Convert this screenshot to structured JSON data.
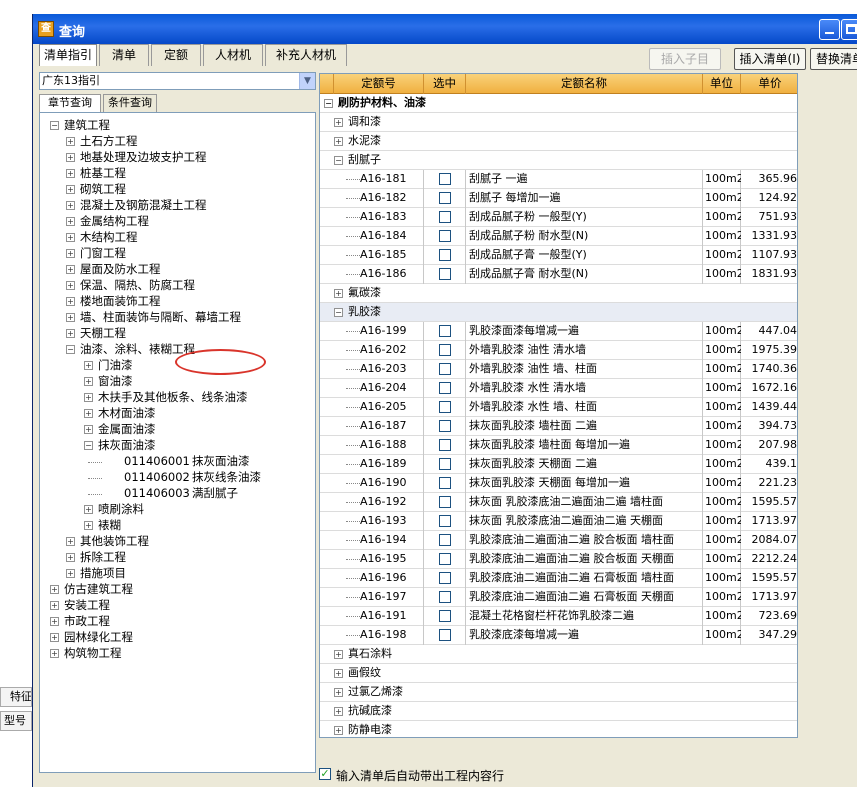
{
  "window": {
    "title": "查询"
  },
  "side": {
    "label1": "特征",
    "label2": "型号"
  },
  "tabs": [
    "清单指引",
    "清单",
    "定额",
    "人材机",
    "补充人材机"
  ],
  "toolbar": {
    "insert_child": "插入子目",
    "insert_list": "插入清单(I)",
    "replace_list": "替换清单"
  },
  "combo": {
    "value": "广东13指引"
  },
  "subtabs": [
    "章节查询",
    "条件查询"
  ],
  "tree": [
    {
      "label": "建筑工程",
      "level": 0,
      "exp": "-"
    },
    {
      "label": "土石方工程",
      "level": 1,
      "exp": "+"
    },
    {
      "label": "地基处理及边坡支护工程",
      "level": 1,
      "exp": "+"
    },
    {
      "label": "桩基工程",
      "level": 1,
      "exp": "+"
    },
    {
      "label": "砌筑工程",
      "level": 1,
      "exp": "+"
    },
    {
      "label": "混凝土及钢筋混凝土工程",
      "level": 1,
      "exp": "+"
    },
    {
      "label": "金属结构工程",
      "level": 1,
      "exp": "+"
    },
    {
      "label": "木结构工程",
      "level": 1,
      "exp": "+"
    },
    {
      "label": "门窗工程",
      "level": 1,
      "exp": "+"
    },
    {
      "label": "屋面及防水工程",
      "level": 1,
      "exp": "+"
    },
    {
      "label": "保温、隔热、防腐工程",
      "level": 1,
      "exp": "+"
    },
    {
      "label": "楼地面装饰工程",
      "level": 1,
      "exp": "+"
    },
    {
      "label": "墙、柱面装饰与隔断、幕墙工程",
      "level": 1,
      "exp": "+"
    },
    {
      "label": "天棚工程",
      "level": 1,
      "exp": "+"
    },
    {
      "label": "油漆、涂料、裱糊工程",
      "level": 1,
      "exp": "-"
    },
    {
      "label": "门油漆",
      "level": 2,
      "exp": "+"
    },
    {
      "label": "窗油漆",
      "level": 2,
      "exp": "+"
    },
    {
      "label": "木扶手及其他板条、线条油漆",
      "level": 2,
      "exp": "+"
    },
    {
      "label": "木材面油漆",
      "level": 2,
      "exp": "+"
    },
    {
      "label": "金属面油漆",
      "level": 2,
      "exp": "+"
    },
    {
      "label": "抹灰面油漆",
      "level": 2,
      "exp": "-"
    },
    {
      "label": "011406001",
      "label2": "抹灰面油漆",
      "level": 3,
      "exp": ""
    },
    {
      "label": "011406002",
      "label2": "抹灰线条油漆",
      "level": 3,
      "exp": ""
    },
    {
      "label": "011406003",
      "label2": "满刮腻子",
      "level": 3,
      "exp": ""
    },
    {
      "label": "喷刷涂料",
      "level": 2,
      "exp": "+"
    },
    {
      "label": "裱糊",
      "level": 2,
      "exp": "+"
    },
    {
      "label": "其他装饰工程",
      "level": 1,
      "exp": "+"
    },
    {
      "label": "拆除工程",
      "level": 1,
      "exp": "+"
    },
    {
      "label": "措施项目",
      "level": 1,
      "exp": "+"
    },
    {
      "label": "仿古建筑工程",
      "level": 0,
      "exp": "+"
    },
    {
      "label": "安装工程",
      "level": 0,
      "exp": "+"
    },
    {
      "label": "市政工程",
      "level": 0,
      "exp": "+"
    },
    {
      "label": "园林绿化工程",
      "level": 0,
      "exp": "+"
    },
    {
      "label": "构筑物工程",
      "level": 0,
      "exp": "+"
    }
  ],
  "grid": {
    "headers": [
      "定额号",
      "选中",
      "定额名称",
      "单位",
      "单价"
    ],
    "rows": [
      {
        "type": "group1",
        "exp": "-",
        "label": "刷防护材料、油漆"
      },
      {
        "type": "group",
        "exp": "+",
        "label": "调和漆"
      },
      {
        "type": "group",
        "exp": "+",
        "label": "水泥漆"
      },
      {
        "type": "group",
        "exp": "-",
        "label": "刮腻子"
      },
      {
        "type": "item",
        "code": "A16-181",
        "name": "刮腻子 一遍",
        "unit": "100m2",
        "price": "365.96"
      },
      {
        "type": "item",
        "code": "A16-182",
        "name": "刮腻子 每增加一遍",
        "unit": "100m2",
        "price": "124.92"
      },
      {
        "type": "item",
        "code": "A16-183",
        "name": "刮成品腻子粉 一般型(Y)",
        "unit": "100m2",
        "price": "751.93"
      },
      {
        "type": "item",
        "code": "A16-184",
        "name": "刮成品腻子粉 耐水型(N)",
        "unit": "100m2",
        "price": "1331.93"
      },
      {
        "type": "item",
        "code": "A16-185",
        "name": "刮成品腻子膏 一般型(Y)",
        "unit": "100m2",
        "price": "1107.93"
      },
      {
        "type": "item",
        "code": "A16-186",
        "name": "刮成品腻子膏 耐水型(N)",
        "unit": "100m2",
        "price": "1831.93"
      },
      {
        "type": "group",
        "exp": "+",
        "label": "氟碳漆"
      },
      {
        "type": "grouphl",
        "exp": "-",
        "label": "乳胶漆"
      },
      {
        "type": "item",
        "code": "A16-199",
        "name": "乳胶漆面漆每增减一遍",
        "unit": "100m2",
        "price": "447.04"
      },
      {
        "type": "item",
        "code": "A16-202",
        "name": "外墙乳胶漆 油性 清水墙",
        "unit": "100m2",
        "price": "1975.39"
      },
      {
        "type": "item",
        "code": "A16-203",
        "name": "外墙乳胶漆 油性 墙、柱面",
        "unit": "100m2",
        "price": "1740.36"
      },
      {
        "type": "item",
        "code": "A16-204",
        "name": "外墙乳胶漆 水性 清水墙",
        "unit": "100m2",
        "price": "1672.16"
      },
      {
        "type": "item",
        "code": "A16-205",
        "name": "外墙乳胶漆 水性 墙、柱面",
        "unit": "100m2",
        "price": "1439.44"
      },
      {
        "type": "item",
        "code": "A16-187",
        "name": "抹灰面乳胶漆 墙柱面 二遍",
        "unit": "100m2",
        "price": "394.73"
      },
      {
        "type": "item",
        "code": "A16-188",
        "name": "抹灰面乳胶漆 墙柱面 每增加一遍",
        "unit": "100m2",
        "price": "207.98"
      },
      {
        "type": "item",
        "code": "A16-189",
        "name": "抹灰面乳胶漆 天棚面 二遍",
        "unit": "100m2",
        "price": "439.1"
      },
      {
        "type": "item",
        "code": "A16-190",
        "name": "抹灰面乳胶漆 天棚面 每增加一遍",
        "unit": "100m2",
        "price": "221.23"
      },
      {
        "type": "item",
        "code": "A16-192",
        "name": "抹灰面 乳胶漆底油二遍面油二遍 墙柱面",
        "unit": "100m2",
        "price": "1595.57"
      },
      {
        "type": "item",
        "code": "A16-193",
        "name": "抹灰面 乳胶漆底油二遍面油二遍 天棚面",
        "unit": "100m2",
        "price": "1713.97"
      },
      {
        "type": "item",
        "code": "A16-194",
        "name": "乳胶漆底油二遍面油二遍 胶合板面 墙柱面",
        "unit": "100m2",
        "price": "2084.07"
      },
      {
        "type": "item",
        "code": "A16-195",
        "name": "乳胶漆底油二遍面油二遍 胶合板面 天棚面",
        "unit": "100m2",
        "price": "2212.24"
      },
      {
        "type": "item",
        "code": "A16-196",
        "name": "乳胶漆底油二遍面油二遍 石膏板面 墙柱面",
        "unit": "100m2",
        "price": "1595.57"
      },
      {
        "type": "item",
        "code": "A16-197",
        "name": "乳胶漆底油二遍面油二遍 石膏板面 天棚面",
        "unit": "100m2",
        "price": "1713.97"
      },
      {
        "type": "item",
        "code": "A16-191",
        "name": "混凝土花格窗栏杆花饰乳胶漆二遍",
        "unit": "100m2",
        "price": "723.69"
      },
      {
        "type": "item",
        "code": "A16-198",
        "name": "乳胶漆底漆每增减一遍",
        "unit": "100m2",
        "price": "347.29"
      },
      {
        "type": "group",
        "exp": "+",
        "label": "真石涂料"
      },
      {
        "type": "group",
        "exp": "+",
        "label": "画假纹"
      },
      {
        "type": "group",
        "exp": "+",
        "label": "过氯乙烯漆"
      },
      {
        "type": "group",
        "exp": "+",
        "label": "抗碱底漆"
      },
      {
        "type": "group",
        "exp": "+",
        "label": "防静电漆"
      }
    ]
  },
  "bottom": {
    "checkbox_label": "输入清单后自动带出工程内容行",
    "checked": true
  },
  "colors": {
    "title_blue": "#0a5ad8",
    "header_orange": "#f0b040",
    "highlight_red": "#d9342b"
  }
}
